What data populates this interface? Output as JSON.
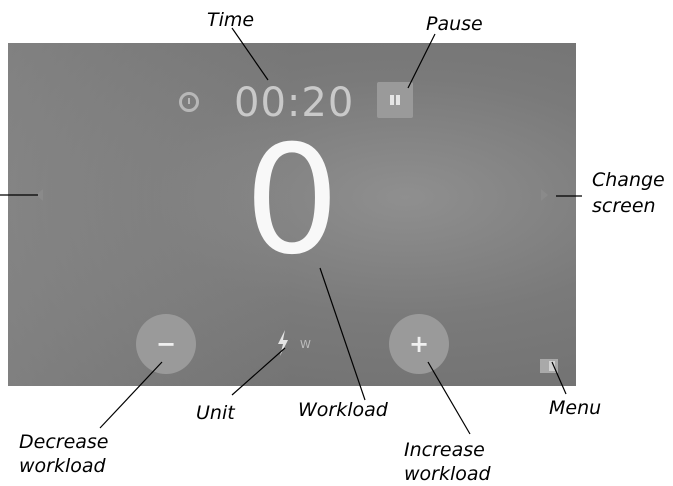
{
  "screen": {
    "time": "00:20",
    "workload": "0",
    "unit": "W",
    "icons": {
      "timer": "timer-icon",
      "pause": "pause-icon",
      "prev": "chevron-left-icon",
      "next": "chevron-right-icon",
      "decrease": "minus-icon",
      "increase": "plus-icon",
      "unit": "lightning-bolt-icon",
      "menu": "menu-icon"
    }
  },
  "callouts": {
    "time": "Time",
    "pause": "Pause",
    "change_screen_line1": "Change",
    "change_screen_line2": "screen",
    "workload": "Workload",
    "unit": "Unit",
    "decrease_line1": "Decrease",
    "decrease_line2": "workload",
    "increase_line1": "Increase",
    "increase_line2": "workload",
    "menu": "Menu"
  },
  "colors": {
    "screen_bg": "#7a7a7a",
    "foreground": "#f8f8f8",
    "button": "#9a9a9a"
  }
}
